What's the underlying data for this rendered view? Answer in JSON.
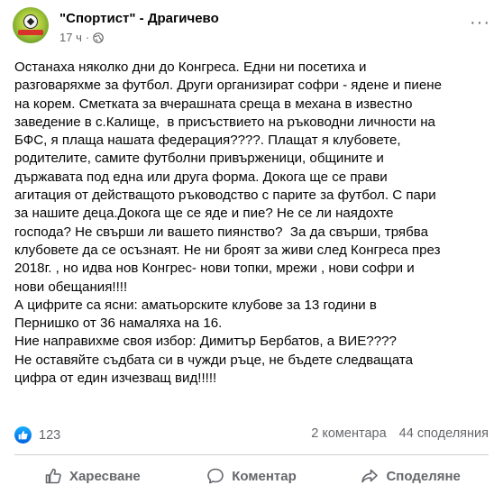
{
  "header": {
    "page_name": "\"Спортист\" - Драгичево",
    "time": "17 ч",
    "separator": "·",
    "more": "···"
  },
  "post": {
    "paragraphs": [
      "Останаха няколко дни до Конгреса. Едни ни посетиха и\nразговаряхме за футбол. Други организират софри - ядене и пиене\nна корем. Сметката за вчерашната среща в механа в известно\nзаведение в с.Калище,  в присъствието на ръководни личности на\nБФС, я плаща нашата федерация????. Плащат я клубовете,\nродителите, самите футболни привърженици, общините и\nдържавата под една или друга форма. Докога ще се прави\nагитация от действащото ръководство с парите за футбол. С пари\nза нашите деца.Докога ще се яде и пие? Не се ли наядохте\nгоспода? Не свърши ли вашето пиянство?  За да свърши, трябва\nклубовете да се осъзнаят. Не ни броят за живи след Конгреса през\n2018г. , но идва нов Конгрес- нови топки, мрежи , нови софри и\nнови обещания!!!!",
      "А цифрите са ясни: аматьорските клубове за 13 години в\nПернишко от 36 намаляха на 16.",
      "Ние направихме своя избор: Димитър Бербатов, а ВИЕ????",
      "Не оставяйте съдбата си в чужди ръце, не бъдете следващата\nцифра от един изчезващ вид!!!!!"
    ]
  },
  "stats": {
    "reactions_count": "123",
    "comments": "2 коментара",
    "shares": "44 споделяния"
  },
  "actions": {
    "like": "Харесване",
    "comment": "Коментар",
    "share": "Споделяне"
  },
  "colors": {
    "text": "#050505",
    "secondary": "#65676b",
    "like_blue": "#1877f2"
  }
}
